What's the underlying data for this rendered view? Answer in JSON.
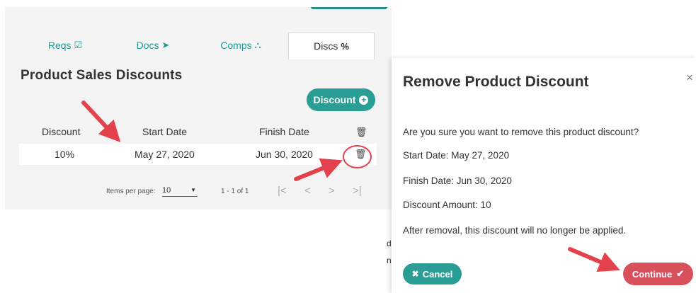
{
  "tabs": [
    {
      "label": "Reqs",
      "icon": "check-square-icon",
      "glyph": "☑"
    },
    {
      "label": "Docs",
      "icon": "paper-plane-icon",
      "glyph": "➤"
    },
    {
      "label": "Comps",
      "icon": "sitemap-icon",
      "glyph": "⛬"
    },
    {
      "label": "Discs",
      "icon": "percent-icon",
      "glyph": "%",
      "active": true
    }
  ],
  "section": {
    "title": "Product Sales Discounts",
    "add_button_label": "Discount"
  },
  "table": {
    "columns": [
      "Discount",
      "Start Date",
      "Finish Date"
    ],
    "rows": [
      {
        "discount": "10%",
        "start_date": "May 27, 2020",
        "finish_date": "Jun 30, 2020"
      }
    ]
  },
  "paginator": {
    "items_per_page_label": "Items per page:",
    "items_per_page_value": "10",
    "range_label": "1 - 1 of 1",
    "first": "|<",
    "prev": "<",
    "next": ">",
    "last": ">|"
  },
  "dialog": {
    "title": "Remove Product Discount",
    "close": "×",
    "question": "Are you sure you want to remove this product discount?",
    "start_date_line": "Start Date: May 27, 2020",
    "finish_date_line": "Finish Date: Jun 30, 2020",
    "amount_line": "Discount Amount: 10",
    "warning_line": "After removal, this discount will no longer be applied.",
    "cancel_label": "Cancel",
    "continue_label": "Continue"
  },
  "background_fragments": [
    "d",
    "n"
  ],
  "colors": {
    "teal": "#2a9d95",
    "danger": "#d9505d",
    "annotation_red": "#e3424c"
  }
}
